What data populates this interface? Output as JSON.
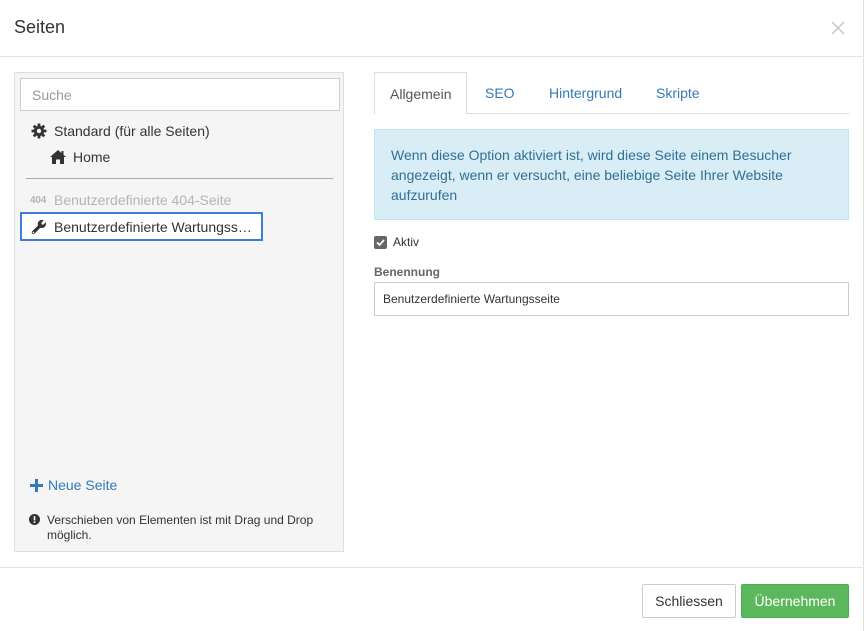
{
  "header": {
    "title": "Seiten",
    "close_label": "×"
  },
  "sidebar": {
    "search_placeholder": "Suche",
    "items": [
      {
        "label": "Standard (für alle Seiten)",
        "icon": "gear-icon"
      },
      {
        "label": "Home",
        "icon": "home-icon"
      },
      {
        "label": "Benutzerdefinierte 404-Seite",
        "badge": "404",
        "disabled": true
      },
      {
        "label": "Benutzerdefinierte Wartungss…",
        "icon": "wrench-icon",
        "selected": true
      }
    ],
    "new_page_label": "Neue Seite",
    "hint": "Verschieben von Elementen ist mit Drag und Drop möglich."
  },
  "main": {
    "tabs": [
      {
        "label": "Allgemein",
        "active": true
      },
      {
        "label": "SEO"
      },
      {
        "label": "Hintergrund"
      },
      {
        "label": "Skripte"
      }
    ],
    "info": "Wenn diese Option aktiviert ist, wird diese Seite einem Besucher angezeigt, wenn er versucht, eine beliebige Seite Ihrer Website aufzurufen",
    "active_label": "Aktiv",
    "active_checked": true,
    "name_label": "Benennung",
    "name_value": "Benutzerdefinierte Wartungsseite"
  },
  "footer": {
    "close_label": "Schliessen",
    "apply_label": "Übernehmen"
  },
  "colors": {
    "link": "#337ab7",
    "info_bg": "#d9edf7",
    "info_text": "#31708f",
    "apply_bg": "#5cb85c",
    "selection_border": "#3b7dd8"
  }
}
